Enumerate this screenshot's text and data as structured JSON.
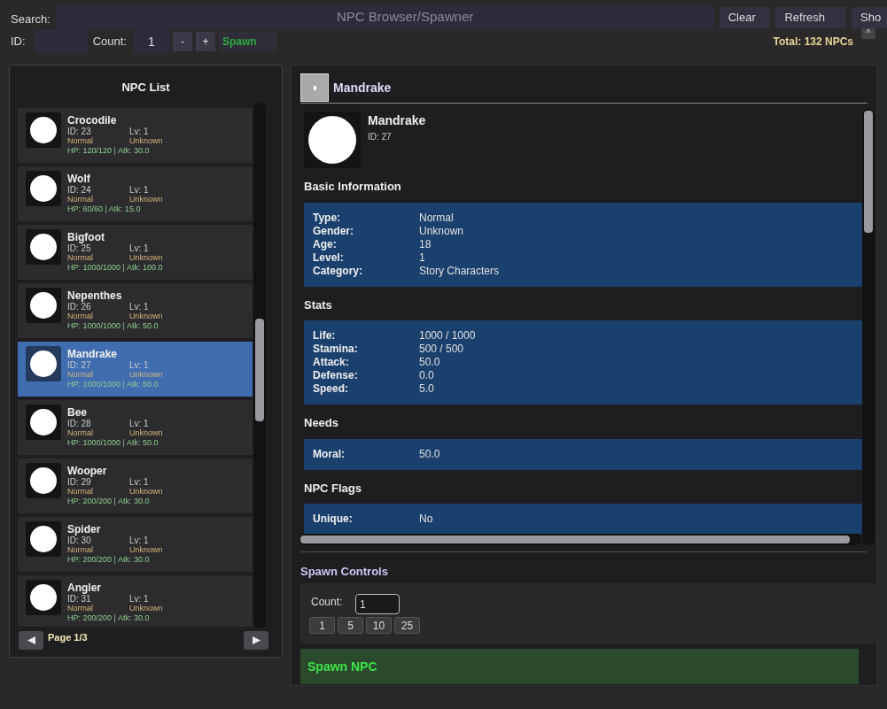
{
  "window": {
    "title": "NPC Browser/Spawner"
  },
  "toolbar": {
    "search_label": "Search:",
    "buttons": [
      "Clear",
      "Refresh",
      "Sho"
    ],
    "collapse": "^",
    "id_label": "ID:",
    "count_label": "Count:",
    "count_value": "1",
    "minus": "-",
    "plus": "+",
    "spawn": "Spawn",
    "total": "Total: 132 NPCs"
  },
  "npc_list": {
    "title": "NPC List",
    "items": [
      {
        "name": "Crocodile",
        "id": "ID: 23",
        "level": "Lv: 1",
        "type": "Normal",
        "gender": "Unknown",
        "stats": "HP: 120/120 | Atk: 30.0",
        "selected": false
      },
      {
        "name": "Wolf",
        "id": "ID: 24",
        "level": "Lv: 1",
        "type": "Normal",
        "gender": "Unknown",
        "stats": "HP: 60/60 | Atk: 15.0",
        "selected": false
      },
      {
        "name": "Bigfoot",
        "id": "ID: 25",
        "level": "Lv: 1",
        "type": "Normal",
        "gender": "Unknown",
        "stats": "HP: 1000/1000 | Atk: 100.0",
        "selected": false
      },
      {
        "name": "Nepenthes",
        "id": "ID: 26",
        "level": "Lv: 1",
        "type": "Normal",
        "gender": "Unknown",
        "stats": "HP: 1000/1000 | Atk: 50.0",
        "selected": false
      },
      {
        "name": "Mandrake",
        "id": "ID: 27",
        "level": "Lv: 1",
        "type": "Normal",
        "gender": "Unknown",
        "stats": "HP: 1000/1000 | Atk: 50.0",
        "selected": true
      },
      {
        "name": "Bee",
        "id": "ID: 28",
        "level": "Lv: 1",
        "type": "Normal",
        "gender": "Unknown",
        "stats": "HP: 1000/1000 | Atk: 50.0",
        "selected": false
      },
      {
        "name": "Wooper",
        "id": "ID: 29",
        "level": "Lv: 1",
        "type": "Normal",
        "gender": "Unknown",
        "stats": "HP: 200/200 | Atk: 30.0",
        "selected": false
      },
      {
        "name": "Spider",
        "id": "ID: 30",
        "level": "Lv: 1",
        "type": "Normal",
        "gender": "Unknown",
        "stats": "HP: 200/200 | Atk: 30.0",
        "selected": false
      },
      {
        "name": "Angler",
        "id": "ID: 31",
        "level": "Lv: 1",
        "type": "Normal",
        "gender": "Unknown",
        "stats": "HP: 200/200 | Atk: 30.0",
        "selected": false
      }
    ],
    "page": "Page 1/3"
  },
  "details": {
    "title": "Mandrake",
    "name": "Mandrake",
    "id": "ID: 27",
    "sections": [
      {
        "title": "Basic Information",
        "rows": [
          {
            "label": "Type:",
            "value": "Normal"
          },
          {
            "label": "Gender:",
            "value": "Unknown"
          },
          {
            "label": "Age:",
            "value": "18"
          },
          {
            "label": "Level:",
            "value": "1"
          },
          {
            "label": "Category:",
            "value": "Story Characters"
          }
        ]
      },
      {
        "title": "Stats",
        "rows": [
          {
            "label": "Life:",
            "value": "1000 / 1000"
          },
          {
            "label": "Stamina:",
            "value": "500 / 500"
          },
          {
            "label": "Attack:",
            "value": "50.0"
          },
          {
            "label": "Defense:",
            "value": "0.0"
          },
          {
            "label": "Speed:",
            "value": "5.0"
          }
        ]
      },
      {
        "title": "Needs",
        "rows": [
          {
            "label": "Moral:",
            "value": "50.0"
          }
        ]
      },
      {
        "title": "NPC Flags",
        "rows": [
          {
            "label": "Unique:",
            "value": "No"
          }
        ]
      }
    ]
  },
  "spawn_controls": {
    "title": "Spawn Controls",
    "count_label": "Count:",
    "count_value": "1",
    "presets": [
      "1",
      "5",
      "10",
      "25"
    ],
    "spawn_button": "Spawn NPC"
  }
}
